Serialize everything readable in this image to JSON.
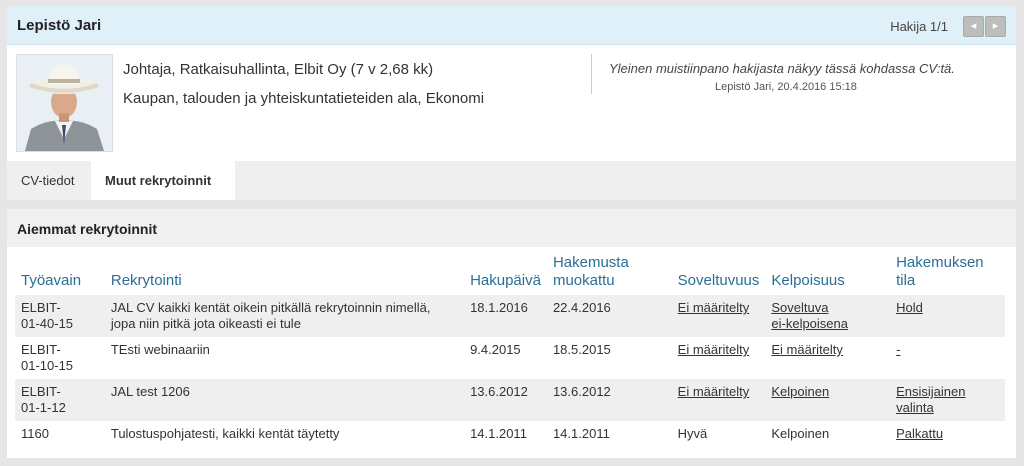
{
  "candidate": {
    "name": "Lepistö Jari",
    "position_text": "Hakija 1/1",
    "prev_icon": "◂",
    "next_icon": "▸",
    "headline1": "Johtaja, Ratkaisuhallinta, Elbit Oy (7 v 2,68 kk)",
    "headline2": "Kaupan, talouden ja yhteiskuntatieteiden ala, Ekonomi",
    "note": "Yleinen muistiinpano hakijasta näkyy tässä kohdassa CV:tä.",
    "note_meta": "Lepistö Jari, 20.4.2016 15:18"
  },
  "tabs": {
    "cv": "CV-tiedot",
    "muut": "Muut rekrytoinnit"
  },
  "section": {
    "title": "Aiemmat rekrytoinnit"
  },
  "table": {
    "headers": {
      "tyoavain": "Työavain",
      "rekrytointi": "Rekrytointi",
      "hakupaiva": "Hakupäivä",
      "muokattu1": "Hakemusta",
      "muokattu2": "muokattu",
      "soveltuvuus": "Soveltuvuus",
      "kelpoisuus": "Kelpoisuus",
      "tila1": "Hakemuksen",
      "tila2": "tila"
    },
    "rows": [
      {
        "key1": "ELBIT-",
        "key2": "01-40-15",
        "rekry1": "JAL CV kaikki kentät oikein pitkällä rekrytoinnin nimellä,",
        "rekry2": "jopa niin pitkä jota oikeasti ei tule",
        "hakupaiva": "18.1.2016",
        "muokattu": "22.4.2016",
        "soveltuvuus": "Ei määritelty",
        "kelpoisuus1": "Soveltuva",
        "kelpoisuus2": "ei-kelpoisena",
        "tila1": "Hold",
        "tila2": ""
      },
      {
        "key1": "ELBIT-",
        "key2": "01-10-15",
        "rekry1": "TEsti webinaariin",
        "rekry2": "",
        "hakupaiva": "9.4.2015",
        "muokattu": "18.5.2015",
        "soveltuvuus": "Ei määritelty",
        "kelpoisuus1": "Ei määritelty",
        "kelpoisuus2": "",
        "tila1": "-",
        "tila2": ""
      },
      {
        "key1": "ELBIT-",
        "key2": "01-1-12",
        "rekry1": "JAL test 1206",
        "rekry2": "",
        "hakupaiva": "13.6.2012",
        "muokattu": "13.6.2012",
        "soveltuvuus": "Ei määritelty",
        "kelpoisuus1": "Kelpoinen",
        "kelpoisuus2": "",
        "tila1": "Ensisijainen",
        "tila2": "valinta"
      },
      {
        "key1": "1160",
        "key2": "",
        "rekry1": "Tulostuspohjatesti, kaikki kentät täytetty",
        "rekry2": "",
        "hakupaiva": "14.1.2011",
        "muokattu": "14.1.2011",
        "soveltuvuus": "Hyvä",
        "kelpoisuus1": "Kelpoinen",
        "kelpoisuus2": "",
        "tila1": "Palkattu",
        "tila2": ""
      }
    ]
  }
}
